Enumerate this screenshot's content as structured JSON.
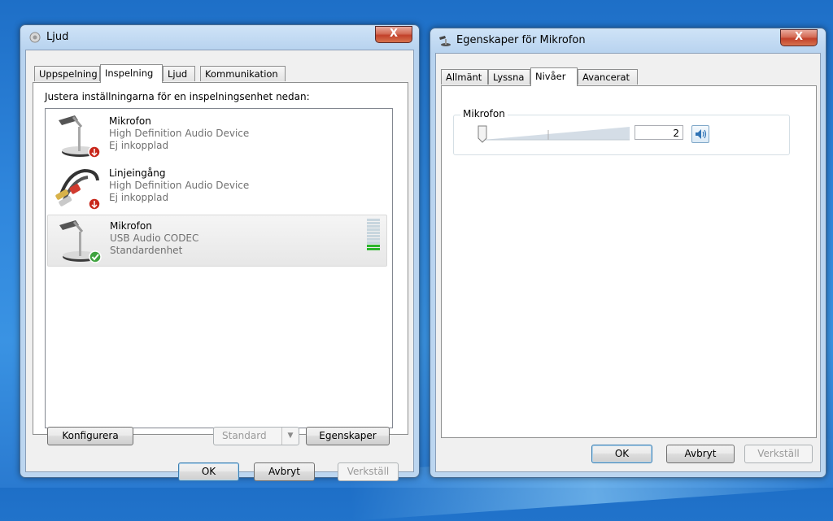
{
  "ljud_window": {
    "title": "Ljud",
    "close": "X",
    "tabs": [
      "Uppspelning",
      "Inspelning",
      "Ljud",
      "Kommunikation"
    ],
    "active_tab": "Inspelning",
    "instruction": "Justera inställningarna för en inspelningsenhet nedan:",
    "devices": [
      {
        "name": "Mikrofon",
        "device": "High Definition Audio Device",
        "status": "Ej inkopplad",
        "icon": "microphone-icon",
        "state_icon": "unplugged-icon"
      },
      {
        "name": "Linjeingång",
        "device": "High Definition Audio Device",
        "status": "Ej inkopplad",
        "icon": "line-in-cable-icon",
        "state_icon": "unplugged-icon"
      },
      {
        "name": "Mikrofon",
        "device": "USB Audio CODEC",
        "status": "Standardenhet",
        "icon": "microphone-icon",
        "state_icon": "default-check-icon",
        "level_segments_lit": 2,
        "level_segments_total": 10
      }
    ],
    "buttons": {
      "configure": "Konfigurera",
      "standard": "Standard",
      "properties": "Egenskaper",
      "ok": "OK",
      "cancel": "Avbryt",
      "apply": "Verkställ"
    }
  },
  "props_window": {
    "title": "Egenskaper för Mikrofon",
    "close": "X",
    "tabs": [
      "Allmänt",
      "Lyssna",
      "Nivåer",
      "Avancerat"
    ],
    "active_tab": "Nivåer",
    "group_label": "Mikrofon",
    "level_value": "2",
    "speaker_icon": "speaker-icon",
    "buttons": {
      "ok": "OK",
      "cancel": "Avbryt",
      "apply": "Verkställ"
    }
  },
  "colors": {
    "accent": "#3c7fb1",
    "level_green": "#2db52d",
    "unplugged_red": "#c8271b",
    "check_green": "#3fa33f"
  }
}
